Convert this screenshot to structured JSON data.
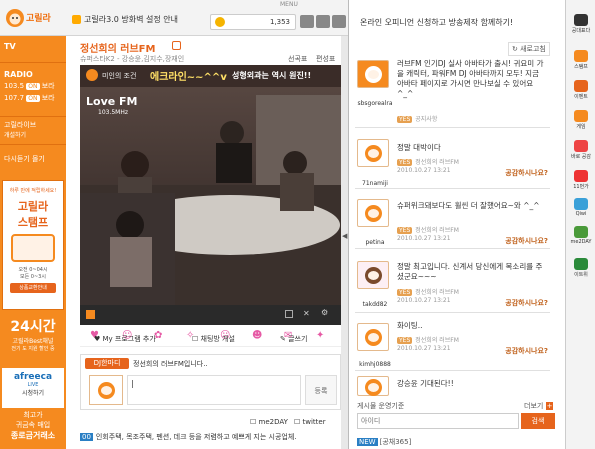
{
  "app": {
    "logo_text": "고릴라",
    "menu_label": "MENU"
  },
  "topbar": {
    "notice": "고릴라3.0 방화벽 설정 안내",
    "coins": "1,353"
  },
  "left": {
    "tv": "TV",
    "radio": "RADIO",
    "radio_freq1": "103.5",
    "radio_label1": "보라",
    "radio_freq2": "107.7",
    "radio_label2": "보라",
    "gorilla_radio": "고릴라이브",
    "gorilla_radio_sub": "개설하기",
    "replay": "다시듣기 몰기",
    "stamp_small": "하루 만에 적립하세요!",
    "stamp_big1": "고릴라",
    "stamp_big2": "스탬프",
    "stamp_note1": "오전 0~04시",
    "stamp_note2": "모든 0~3시",
    "stamp_btn": "상품교환안내",
    "hours": "24시간",
    "hours_sub1": "고릴라Best채널",
    "hours_sub2": "전기 도 지원 할인 중",
    "afreeca": "afreeca",
    "afreeca_live": "LIVE",
    "afreeca_sub": "시청하기",
    "bottom1": "최고가",
    "bottom2": "귀금속 매입",
    "bottom3": "종로금거래소"
  },
  "main": {
    "title": "정선희의 러브FM",
    "subtitle": "슈퍼스타K2 - 강승윤,김지수,장재인",
    "links": [
      "선곡표",
      "편성표"
    ],
    "video_banner_small": "미인의 조건",
    "video_banner_big": "에크라인~~^^v",
    "video_banner_tail": "성형외과는 역시 원진!!",
    "video_logo": "Love FM",
    "video_freq": "103.5MHz",
    "actions": [
      "My 프로그램 추가",
      "채팅방 개설",
      "글쓰기"
    ],
    "dj_badge": "DJ한마디",
    "dj_text": "정선희의 러브FM입니다..",
    "dj_input_value": "|",
    "dj_submit": "등록",
    "share1": "me2DAY",
    "share2": "twitter",
    "bottom_badge": "00",
    "bottom_note": "인회주택, 목조주택, 펜션, 데크 등을 저렴하고 예쁘게 지는 시공업체."
  },
  "right": {
    "header": "온라인 오피니언 신청하고 방송제작 함께하기!",
    "refresh": "새로고침",
    "posts": [
      {
        "user": "sbsgorealra",
        "text": "러브FM 인기DJ 실사 아바타가 출시! 귀요미 가을 캐릭터, 파워FM DJ 아바타까지 모두! 지금 아바타 페이지로 가시면 만나보실 수 있어요^_^",
        "meta": "공지사항",
        "date": "",
        "action": ""
      },
      {
        "user": "71namiji",
        "text": "정말 대박이다",
        "meta": "정선희의 러브FM",
        "date": "2010.10.27 13:21",
        "action": "공감하시나요?"
      },
      {
        "user": "petina",
        "text": "슈퍼위크돼보다도 훨씬 더 잘했어요~와 ^_^",
        "meta": "정선희의 러브FM",
        "date": "2010.10.27 13:21",
        "action": "공감하시나요?"
      },
      {
        "user": "takdd82",
        "text": "정말 최고입니다. 신계서 당신에게 목소리를 주셨군요~~~",
        "meta": "정선희의 러브FM",
        "date": "2010.10.27 13:21",
        "action": "공감하시나요?"
      },
      {
        "user": "kimhj0888",
        "text": "화이팅..",
        "meta": "정선희의 러브FM",
        "date": "2010.10.27 13:21",
        "action": "공감하시나요?"
      },
      {
        "user": "",
        "text": "강승윤 기대된다!!",
        "meta": "",
        "date": "",
        "action": ""
      }
    ],
    "footer_left": "게시물 운영기준",
    "footer_more": "더보기",
    "id_placeholder": "아이디",
    "search_btn": "검색",
    "channel": "[공채365]"
  },
  "rightsb": [
    "공대표다",
    "스탬프",
    "이벤트",
    "게임",
    "바로 공감",
    "11번가",
    "Qiwi",
    "me2DAY",
    "이트위",
    "미트레카"
  ]
}
